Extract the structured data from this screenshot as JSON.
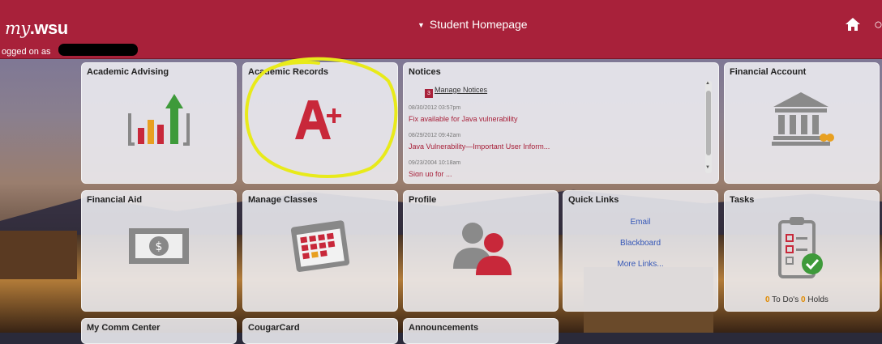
{
  "header": {
    "logo_prefix": "my",
    "logo_suffix": ".wsu",
    "logged_on_label": "ogged on as",
    "page_title": "Student Homepage",
    "caret_icon": "caret-down-icon",
    "home_icon": "home-icon",
    "search_icon": "search-icon"
  },
  "tiles": {
    "academic_advising": "Academic Advising",
    "academic_records": "Academic Records",
    "notices": "Notices",
    "financial_account": "Financial Account",
    "financial_aid": "Financial Aid",
    "manage_classes": "Manage Classes",
    "profile": "Profile",
    "quick_links": "Quick Links",
    "tasks": "Tasks",
    "my_comm_center": "My Comm Center",
    "cougarcard": "CougarCard",
    "announcements": "Announcements"
  },
  "notices": {
    "manage_label": "Manage Notices",
    "items": [
      {
        "date": "08/30/2012 03:57pm",
        "text": "Fix available for Java vulnerability"
      },
      {
        "date": "08/29/2012 09:42am",
        "text": "Java Vulnerability—Important User Inform..."
      },
      {
        "date": "09/23/2004 10:18am",
        "text": "Sign up for ..."
      }
    ]
  },
  "quick_links": {
    "items": [
      "Email",
      "Blackboard",
      "More Links..."
    ]
  },
  "tasks": {
    "todo_count": "0",
    "todo_label": "To Do's",
    "holds_count": "0",
    "holds_label": "Holds"
  },
  "colors": {
    "brand": "#a8213a",
    "link": "#3557b7",
    "accent": "#e08a00",
    "highlight": "#e8ea1a"
  },
  "icons": {
    "advising": "bar-chart-icon",
    "records": "grade-a-plus-icon",
    "account": "bank-icon",
    "aid": "money-bill-icon",
    "classes": "calendar-icon",
    "profile": "users-icon",
    "tasks": "clipboard-check-icon"
  }
}
